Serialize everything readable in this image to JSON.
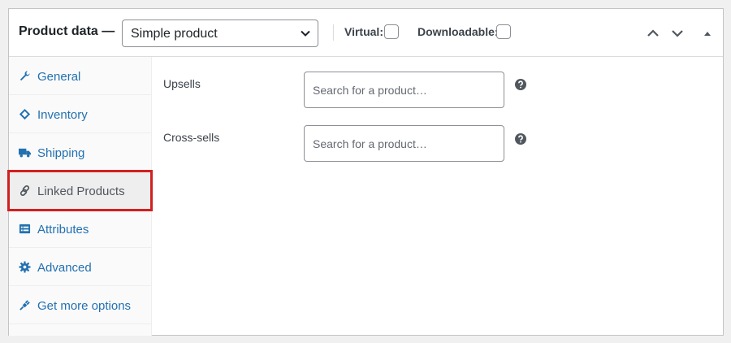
{
  "header": {
    "title": "Product data —",
    "product_type": "Simple product",
    "virtual_label": "Virtual:",
    "downloadable_label": "Downloadable:"
  },
  "tabs": [
    {
      "label": "General",
      "icon": "wrench-icon"
    },
    {
      "label": "Inventory",
      "icon": "tag-icon"
    },
    {
      "label": "Shipping",
      "icon": "truck-icon"
    },
    {
      "label": "Linked Products",
      "icon": "link-icon",
      "active": true
    },
    {
      "label": "Attributes",
      "icon": "list-icon"
    },
    {
      "label": "Advanced",
      "icon": "gear-icon"
    },
    {
      "label": "Get more options",
      "icon": "plug-icon"
    }
  ],
  "fields": {
    "upsells": {
      "label": "Upsells",
      "placeholder": "Search for a product…"
    },
    "crosssells": {
      "label": "Cross-sells",
      "placeholder": "Search for a product…"
    }
  },
  "colors": {
    "link": "#2271b1",
    "highlight": "#d21f20",
    "border": "#c3c4c7"
  }
}
